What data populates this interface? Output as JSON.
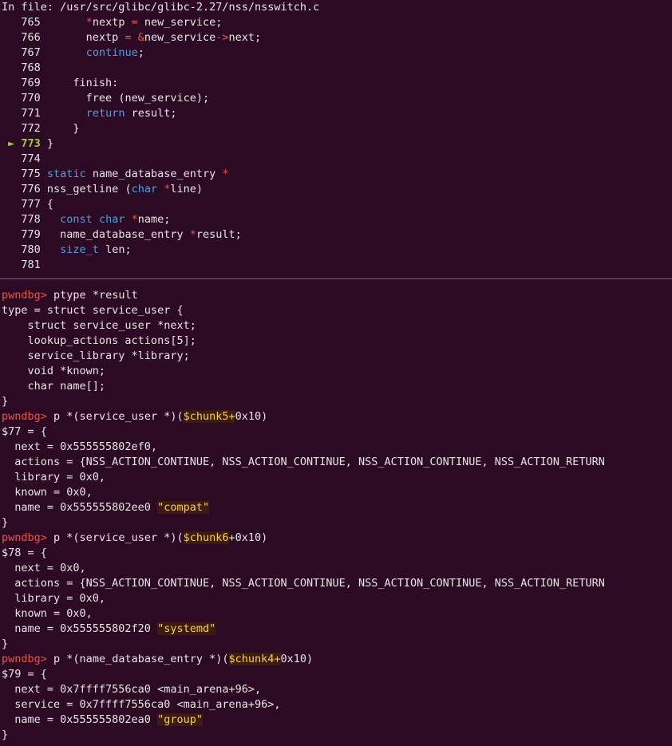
{
  "file_header": "In file: /usr/src/glibc/glibc-2.27/nss/nsswitch.c",
  "source": [
    {
      "n": "765",
      "code": "      *nextp = new_service;"
    },
    {
      "n": "766",
      "code": "      nextp = &new_service->next;"
    },
    {
      "n": "767",
      "code": "      continue;"
    },
    {
      "n": "768",
      "code": ""
    },
    {
      "n": "769",
      "code": "    finish:"
    },
    {
      "n": "770",
      "code": "      free (new_service);"
    },
    {
      "n": "771",
      "code": "      return result;"
    },
    {
      "n": "772",
      "code": "    }"
    },
    {
      "n": "773",
      "code": "}",
      "current": true,
      "marker": "►"
    },
    {
      "n": "774",
      "code": ""
    },
    {
      "n": "775",
      "code": "static name_database_entry *"
    },
    {
      "n": "776",
      "code": "nss_getline (char *line)"
    },
    {
      "n": "777",
      "code": "{"
    },
    {
      "n": "778",
      "code": "  const char *name;"
    },
    {
      "n": "779",
      "code": "  name_database_entry *result;"
    },
    {
      "n": "780",
      "code": "  size_t len;"
    },
    {
      "n": "781",
      "code": ""
    }
  ],
  "prompt": "pwndbg>",
  "cmd1": "ptype *result",
  "ptype": [
    "type = struct service_user {",
    "    struct service_user *next;",
    "    lookup_actions actions[5];",
    "    service_library *library;",
    "    void *known;",
    "    char name[];",
    "}"
  ],
  "cmd2": {
    "pre": "p *(service_user *)(",
    "var": "$chunk5+",
    "post": "0x10)"
  },
  "out77": {
    "head": "$77 = {",
    "next": "  next = 0x555555802ef0,",
    "actions": "  actions = {NSS_ACTION_CONTINUE, NSS_ACTION_CONTINUE, NSS_ACTION_CONTINUE, NSS_ACTION_RETURN",
    "library": "  library = 0x0,",
    "known": "  known = 0x0,",
    "name_pre": "  name = 0x555555802ee0 ",
    "name_str": "\"compat\"",
    "close": "}"
  },
  "cmd3": {
    "pre": "p *(service_user *)(",
    "var": "$chunk6",
    "post": "+0x10)"
  },
  "out78": {
    "head": "$78 = {",
    "next": "  next = 0x0,",
    "actions": "  actions = {NSS_ACTION_CONTINUE, NSS_ACTION_CONTINUE, NSS_ACTION_CONTINUE, NSS_ACTION_RETURN",
    "library": "  library = 0x0,",
    "known": "  known = 0x0,",
    "name_pre": "  name = 0x555555802f20 ",
    "name_str": "\"systemd\"",
    "close": "}"
  },
  "cmd4": {
    "pre": "p *(name_database_entry *)(",
    "var": "$chunk4+",
    "post": "0x10)"
  },
  "out79": {
    "head": "$79 = {",
    "next": "  next = 0x7ffff7556ca0 <main_arena+96>,",
    "service": "  service = 0x7ffff7556ca0 <main_arena+96>,",
    "name_pre": "  name = 0x555555802ea0 ",
    "name_str": "\"group\"",
    "close": "}"
  },
  "colors": {
    "background": "#2c0a23",
    "prompt": "#e8584a",
    "keyword": "#4f9fe0",
    "string": "#f5d23b",
    "current_line": "#9fcf3a",
    "separator": "#5a6da8"
  }
}
